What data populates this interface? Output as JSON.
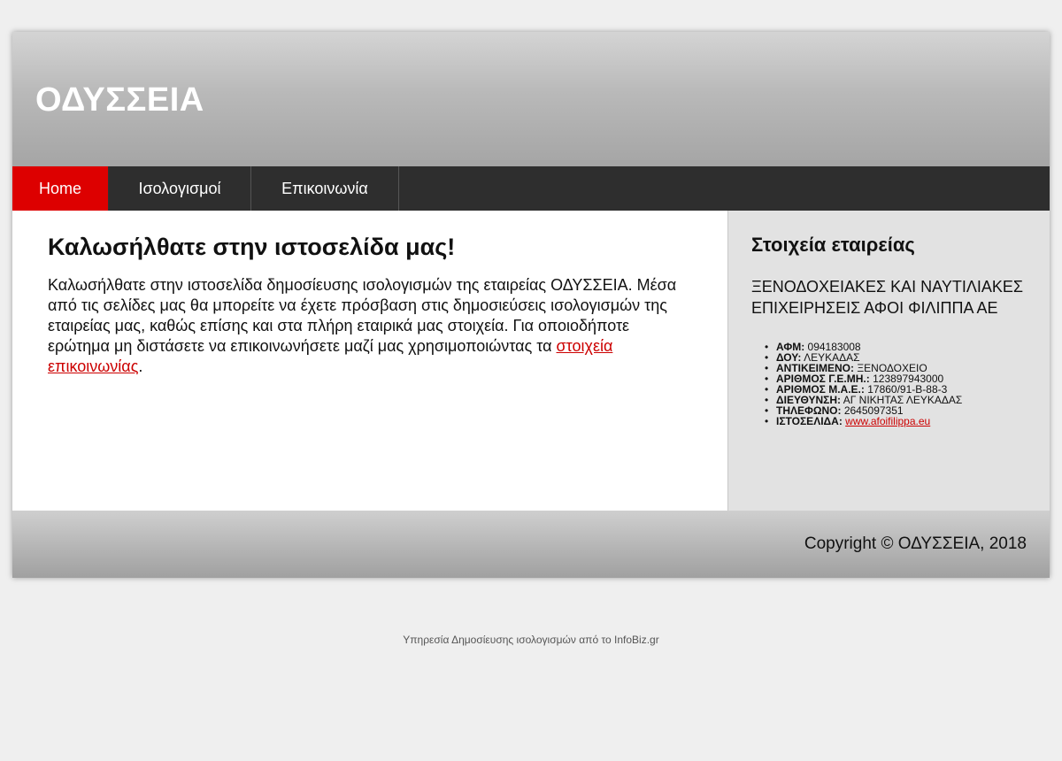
{
  "header": {
    "title": "ΟΔΥΣΣΕΙΑ"
  },
  "nav": {
    "items": [
      {
        "label": "Home"
      },
      {
        "label": "Ισολογισμοί"
      },
      {
        "label": "Επικοινωνία"
      }
    ]
  },
  "main": {
    "heading": "Καλωσήλθατε στην ιστοσελίδα μας!",
    "paragraph": "Καλωσήλθατε στην ιστοσελίδα δημοσίευσης ισολογισμών της εταιρείας ΟΔΥΣΣΕΙΑ. Μέσα από τις σελίδες μας θα μπορείτε να έχετε πρόσβαση στις δημοσιεύσεις ισολογισμών της εταιρείας μας, καθώς επίσης και στα πλήρη εταιρικά μας στοιχεία. Για οποιοδήποτε ερώτημα μη διστάσετε να επικοινωνήσετε μαζί μας χρησιμοποιώντας τα ",
    "contact_link": "στοιχεία επικοινωνίας",
    "paragraph_end": "."
  },
  "sidebar": {
    "heading": "Στοιχεία εταιρείας",
    "company_name": "ΞΕΝΟΔΟΧΕΙΑΚΕΣ ΚΑΙ ΝΑΥΤΙΛΙΑΚΕΣ ΕΠΙΧΕΙΡΗΣΕΙΣ ΑΦΟΙ ΦΙΛΙΠΠΑ ΑΕ",
    "info": [
      {
        "label": "ΑΦΜ:",
        "value": "094183008"
      },
      {
        "label": "ΔΟΥ:",
        "value": "ΛΕΥΚΑΔΑΣ"
      },
      {
        "label": "ΑΝΤΙΚΕΙΜΕΝΟ:",
        "value": "ΞΕΝΟΔΟΧΕΙΟ"
      },
      {
        "label": "ΑΡΙΘΜΟΣ Γ.Ε.ΜΗ.:",
        "value": "123897943000"
      },
      {
        "label": "ΑΡΙΘΜΟΣ Μ.Α.Ε.:",
        "value": "17860/91-B-88-3"
      },
      {
        "label": "ΔΙΕΥΘΥΝΣΗ:",
        "value": "ΑΓ ΝΙΚΗΤΑΣ ΛΕΥΚΑΔΑΣ"
      },
      {
        "label": "ΤΗΛΕΦΩΝΟ:",
        "value": "2645097351"
      },
      {
        "label": "ΙΣΤΟΣΕΛΙΔΑ:",
        "value": "www.afoifilippa.eu"
      }
    ]
  },
  "footer": {
    "copyright": "Copyright © ΟΔΥΣΣΕΙΑ, 2018"
  },
  "service_note": "Υπηρεσία Δημοσίευσης ισολογισμών από το InfoBiz.gr",
  "colors": {
    "accent": "#dd0000",
    "nav_bg": "#2e2e2e",
    "link": "#cc0000",
    "sidebar_bg": "#e2e2e2"
  }
}
